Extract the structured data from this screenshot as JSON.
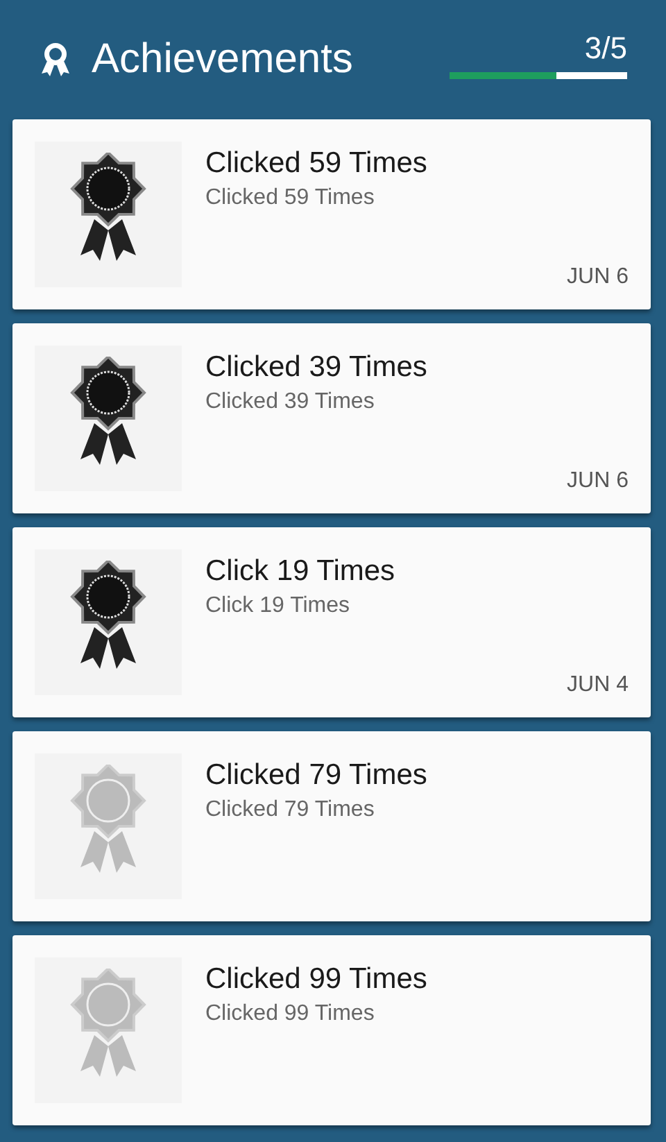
{
  "header": {
    "title": "Achievements",
    "count": "3/5",
    "level": 0.6
  },
  "achievements": [
    {
      "title": "Clicked 59 Times",
      "description": "Clicked 59 Times",
      "unlocked": true,
      "date": "JUN 6"
    },
    {
      "title": "Clicked 39 Times",
      "description": "Clicked 39 Times",
      "unlocked": true,
      "date": "JUN 6"
    },
    {
      "title": "Click 19 Times",
      "description": "Click 19 Times",
      "unlocked": true,
      "date": "JUN 4"
    },
    {
      "title": "Clicked 79 Times",
      "description": "Clicked 79 Times",
      "unlocked": false
    },
    {
      "title": "Clicked 99 Times",
      "description": "Clicked 99 Times",
      "unlocked": false
    }
  ]
}
